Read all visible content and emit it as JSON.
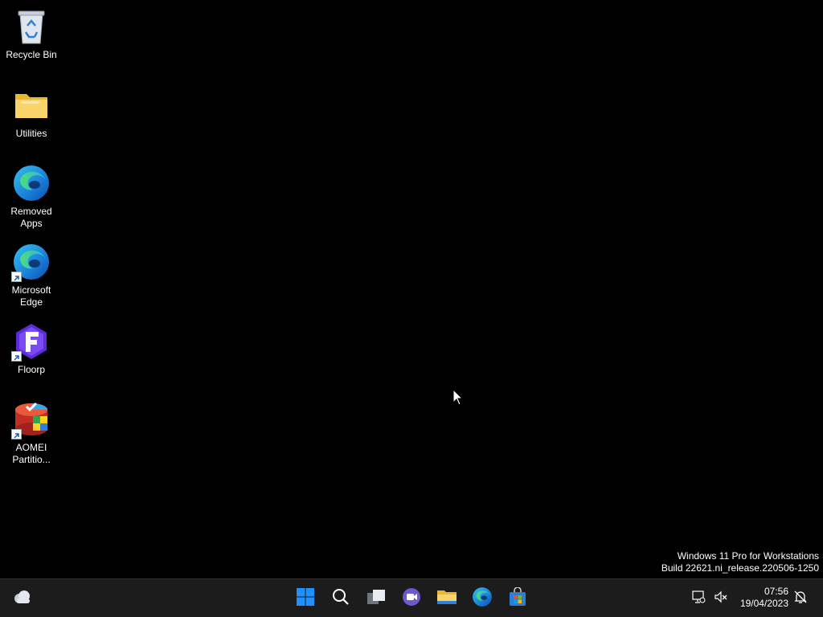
{
  "desktop": {
    "icons": [
      {
        "label": "Recycle Bin",
        "icon": "recycle-bin-icon"
      },
      {
        "label": "Utilities",
        "icon": "folder-icon"
      },
      {
        "label": "Removed Apps",
        "icon": "edge-icon"
      },
      {
        "label": "Microsoft Edge",
        "icon": "edge-icon"
      },
      {
        "label": "Floorp",
        "icon": "floorp-icon"
      },
      {
        "label": "AOMEI Partitio...",
        "icon": "aomei-partition-icon"
      }
    ]
  },
  "watermark": {
    "line1": "Windows 11 Pro for Workstations",
    "line2": "Build 22621.ni_release.220506-1250"
  },
  "taskbar": {
    "widgets_icon": "weather-cloud-icon",
    "pinned": [
      "start-icon",
      "search-icon",
      "task-view-icon",
      "chat-icon",
      "file-explorer-icon",
      "edge-icon",
      "store-icon"
    ],
    "tray": {
      "network_icon": "network-icon",
      "volume_icon": "volume-muted-icon",
      "time": "07:56",
      "date": "19/04/2023",
      "notification_icon": "notification-icon"
    }
  },
  "colors": {
    "background": "#000000",
    "taskbar": "#1c1c1c",
    "start_blue": "#1e90ff",
    "folder_yellow": "#f4c542"
  }
}
